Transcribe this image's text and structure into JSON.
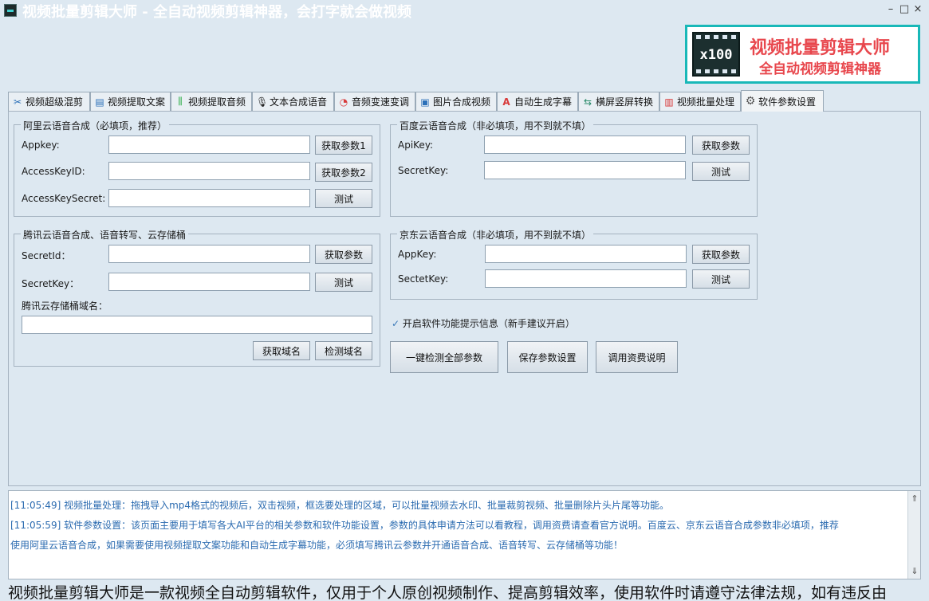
{
  "window": {
    "title": "视频批量剪辑大师 - 全自动视频剪辑神器，会打字就会做视频",
    "minimize": "–",
    "maximize": "□",
    "close": "×"
  },
  "logo": {
    "badge": "x100",
    "title": "视频批量剪辑大师",
    "subtitle": "全自动视频剪辑神器"
  },
  "tabs": [
    {
      "label": "视频超级混剪",
      "icon": "scissors-icon",
      "glyph": "✂"
    },
    {
      "label": "视频提取文案",
      "icon": "document-icon",
      "glyph": "▤"
    },
    {
      "label": "视频提取音频",
      "icon": "waveform-icon",
      "glyph": "⫼"
    },
    {
      "label": "文本合成语音",
      "icon": "microphone-icon",
      "glyph": "🎙"
    },
    {
      "label": "音频变速变调",
      "icon": "gauge-icon",
      "glyph": "◔"
    },
    {
      "label": "图片合成视频",
      "icon": "image-icon",
      "glyph": "▣"
    },
    {
      "label": "自动生成字幕",
      "icon": "font-icon",
      "glyph": "A"
    },
    {
      "label": "横屏竖屏转换",
      "icon": "rotate-screen-icon",
      "glyph": "⇆"
    },
    {
      "label": "视频批量处理",
      "icon": "film-icon",
      "glyph": "▥"
    },
    {
      "label": "软件参数设置",
      "icon": "gear-icon",
      "glyph": "⚙"
    }
  ],
  "aliyun": {
    "title": "阿里云语音合成（必填项，推荐）",
    "appkey_label": "Appkey:",
    "appkey_value": "",
    "accesskeyid_label": "AccessKeyID:",
    "accesskeyid_value": "",
    "accesskeysecret_label": "AccessKeySecret:",
    "accesskeysecret_value": "",
    "get_param1": "获取参数1",
    "get_param2": "获取参数2",
    "test": "测试"
  },
  "baidu": {
    "title": "百度云语音合成（非必填项，用不到就不填）",
    "apikey_label": "ApiKey:",
    "apikey_value": "",
    "secretkey_label": "SecretKey:",
    "secretkey_value": "",
    "get_param": "获取参数",
    "test": "测试"
  },
  "tencent": {
    "title": "腾讯云语音合成、语音转写、云存储桶",
    "secretid_label": "SecretId：",
    "secretid_value": "",
    "secretkey_label": "SecretKey：",
    "secretkey_value": "",
    "bucket_label": "腾讯云存储桶域名：",
    "bucket_value": "",
    "get_param": "获取参数",
    "test": "测试",
    "get_domain": "获取域名",
    "check_domain": "检测域名"
  },
  "jd": {
    "title": "京东云语音合成（非必填项，用不到就不填）",
    "appkey_label": "AppKey:",
    "appkey_value": "",
    "sectetkey_label": "SectetKey:",
    "sectetkey_value": "",
    "get_param": "获取参数",
    "test": "测试"
  },
  "options": {
    "tip_check_mark": "✓",
    "tip_label": "开启软件功能提示信息（新手建议开启）",
    "check_all": "一键检测全部参数",
    "save": "保存参数设置",
    "billing": "调用资费说明"
  },
  "log": {
    "lines": [
      "[11:05:49] 视频批量处理：拖拽导入mp4格式的视频后，双击视频，框选要处理的区域，可以批量视频去水印、批量裁剪视频、批量删除片头片尾等功能。",
      "[11:05:59] 软件参数设置：该页面主要用于填写各大AI平台的相关参数和软件功能设置，参数的具体申请方法可以看教程，调用资费请查看官方说明。百度云、京东云语音合成参数非必填项，推荐",
      "使用阿里云语音合成，如果需要使用视频提取文案功能和自动生成字幕功能，必须填写腾讯云参数并开通语音合成、语音转写、云存储桶等功能！"
    ],
    "scroll_up": "⇑",
    "scroll_down": "⇓"
  },
  "marquee": "视频批量剪辑大师是一款视频全自动剪辑软件，仅用于个人原创视频制作、提高剪辑效率，使用软件时请遵守法律法规，如有违反由"
}
